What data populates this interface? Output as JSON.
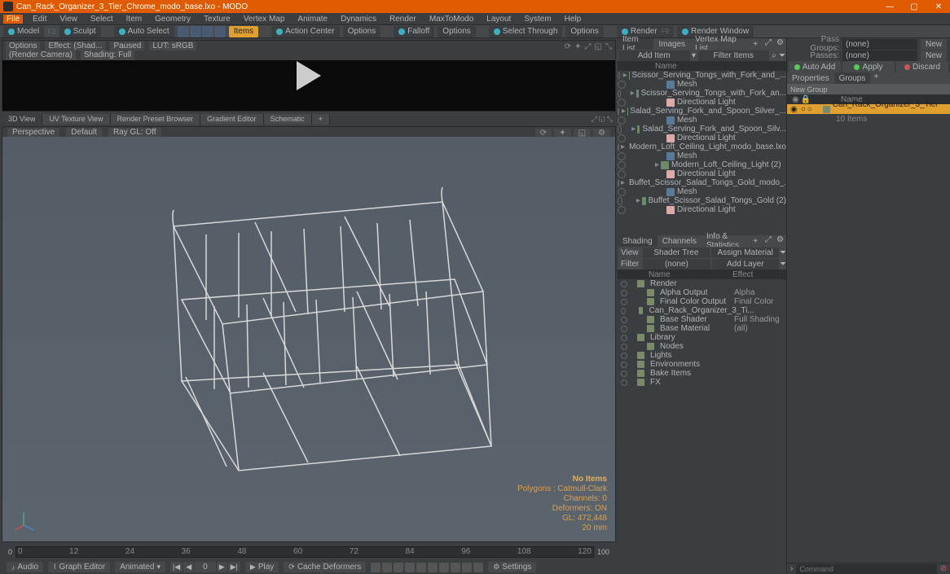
{
  "title": "Can_Rack_Organizer_3_Tier_Chrome_modo_base.lxo - MODO",
  "menu": [
    "File",
    "Edit",
    "View",
    "Select",
    "Item",
    "Geometry",
    "Texture",
    "Vertex Map",
    "Animate",
    "Dynamics",
    "Render",
    "MaxToModo",
    "Layout",
    "System",
    "Help"
  ],
  "toolbar": {
    "model": "Model",
    "sculpt": "Sculpt",
    "autoselect": "Auto Select",
    "items": "Items",
    "actionCenter": "Action Center",
    "options": "Options",
    "falloff": "Falloff",
    "options2": "Options",
    "selectThrough": "Select Through",
    "options3": "Options",
    "render": "Render",
    "renderWindow": "Render Window"
  },
  "preview": {
    "options": "Options",
    "effect": "Effect: (Shad...",
    "paused": "Paused",
    "lut": "LUT: sRGB",
    "renderCamera": "(Render Camera)",
    "shadingFull": "Shading: Full"
  },
  "viewTabs": [
    "3D View",
    "UV Texture View",
    "Render Preset Browser",
    "Gradient Editor",
    "Schematic"
  ],
  "vpBar": {
    "perspective": "Perspective",
    "default": "Default",
    "raygl": "Ray GL: Off"
  },
  "vpStats": {
    "header": "No Items",
    "poly": "Polygons : Catmull-Clark",
    "channels": "Channels: 0",
    "deformers": "Deformers: ON",
    "gl": "GL: 472,448",
    "unit": "20 mm"
  },
  "timeline": {
    "start": "0",
    "end": "120"
  },
  "bottombar": {
    "audio": "Audio",
    "graphEditor": "Graph Editor",
    "animated": "Animated",
    "frame": "0",
    "play": "Play",
    "cacheDeformers": "Cache Deformers",
    "settings": "Settings"
  },
  "itemPanel": {
    "tabs": [
      "Item List",
      "Images",
      "Vertex Map List"
    ],
    "addItem": "Add Item",
    "filterItems": "Filter Items",
    "cols": {
      "v": "",
      "name": "Name"
    },
    "tree": [
      {
        "d": 1,
        "t": "grp",
        "n": "Scissor_Serving_Tongs_with_Fork_and_..."
      },
      {
        "d": 2,
        "t": "mesh",
        "n": "Mesh"
      },
      {
        "d": 1,
        "t": "grp",
        "n": "Scissor_Serving_Tongs_with_Fork_an..."
      },
      {
        "d": 2,
        "t": "light",
        "n": "Directional Light"
      },
      {
        "d": 1,
        "t": "grp",
        "n": "Salad_Serving_Fork_and_Spoon_Silver_..."
      },
      {
        "d": 2,
        "t": "mesh",
        "n": "Mesh"
      },
      {
        "d": 1,
        "t": "grp",
        "n": "Salad_Serving_Fork_and_Spoon_Silv..."
      },
      {
        "d": 2,
        "t": "light",
        "n": "Directional Light"
      },
      {
        "d": 1,
        "t": "grp",
        "n": "Modern_Loft_Ceiling_Light_modo_base.lxo"
      },
      {
        "d": 2,
        "t": "mesh",
        "n": "Mesh"
      },
      {
        "d": 1,
        "t": "grp",
        "n": "Modern_Loft_Ceiling_Light (2)"
      },
      {
        "d": 2,
        "t": "light",
        "n": "Directional Light"
      },
      {
        "d": 1,
        "t": "grp",
        "n": "Buffet_Scissor_Salad_Tongs_Gold_modo_..."
      },
      {
        "d": 2,
        "t": "mesh",
        "n": "Mesh"
      },
      {
        "d": 1,
        "t": "grp",
        "n": "Buffet_Scissor_Salad_Tongs_Gold (2)"
      },
      {
        "d": 2,
        "t": "light",
        "n": "Directional Light"
      }
    ]
  },
  "shadingPanel": {
    "tabs": [
      "Shading",
      "Channels",
      "Info & Statistics"
    ],
    "view": "View",
    "shaderTree": "Shader Tree",
    "assignMaterial": "Assign Material",
    "filter": "Filter",
    "none": "(none)",
    "addLayer": "Add Layer",
    "cols": {
      "name": "Name",
      "effect": "Effect"
    },
    "rows": [
      {
        "n": "Render",
        "e": "",
        "d": 0,
        "ico": "globe"
      },
      {
        "n": "Alpha Output",
        "e": "Alpha",
        "d": 1,
        "ico": "out"
      },
      {
        "n": "Final Color Output",
        "e": "Final Color",
        "d": 1,
        "ico": "out"
      },
      {
        "n": "Can_Rack_Organizer_3_Ti...",
        "e": "",
        "d": 1,
        "ico": "grp"
      },
      {
        "n": "Base Shader",
        "e": "Full Shading",
        "d": 1,
        "ico": "shader"
      },
      {
        "n": "Base Material",
        "e": "(all)",
        "d": 1,
        "ico": "mat"
      },
      {
        "n": "Library",
        "e": "",
        "d": 0,
        "ico": "fold"
      },
      {
        "n": "Nodes",
        "e": "",
        "d": 1,
        "ico": "fold"
      },
      {
        "n": "Lights",
        "e": "",
        "d": 0,
        "ico": "plain"
      },
      {
        "n": "Environments",
        "e": "",
        "d": 0,
        "ico": "plain"
      },
      {
        "n": "Bake Items",
        "e": "",
        "d": 0,
        "ico": "plain"
      },
      {
        "n": "FX",
        "e": "",
        "d": 0,
        "ico": "fx"
      }
    ]
  },
  "farright": {
    "passGroups": "Pass Groups:",
    "passes": "Passes:",
    "none": "(none)",
    "new": "New",
    "autoAdd": "Auto Add",
    "apply": "Apply",
    "discard": "Discard",
    "tabs": [
      "Properties",
      "Groups"
    ],
    "newGroup": "New Group",
    "nameCol": "Name",
    "groupItem": "Can_Rack_Organizer_3_Tier ...",
    "groupSub": "10 Items",
    "command": "Command"
  }
}
